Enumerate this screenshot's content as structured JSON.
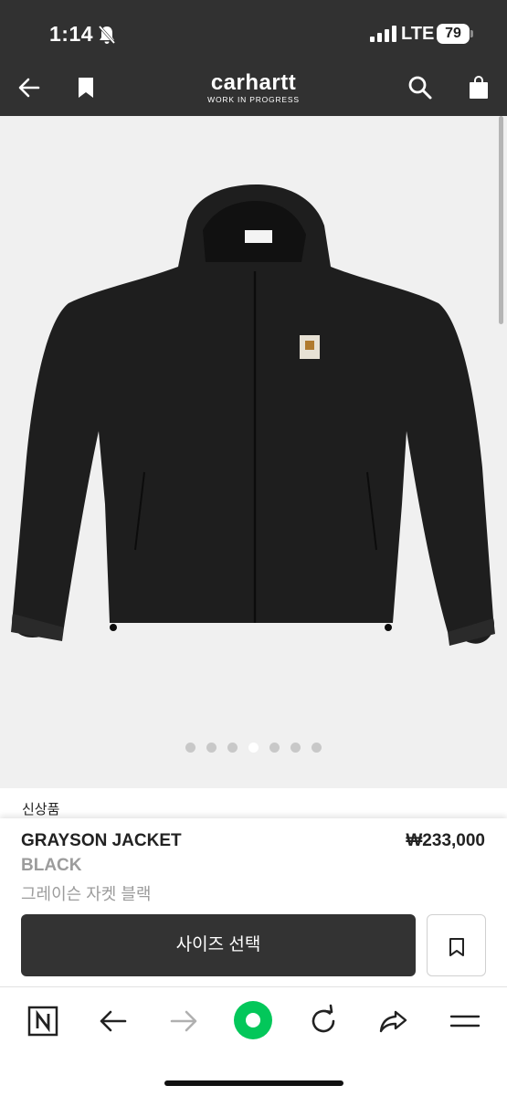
{
  "status_bar": {
    "time": "1:14",
    "network": "LTE",
    "battery": "79"
  },
  "header": {
    "brand": "carhartt",
    "brand_tagline": "WORK IN PROGRESS",
    "icons": [
      "back-arrow-icon",
      "bookmark-icon",
      "search-icon",
      "shopping-bag-icon"
    ]
  },
  "gallery": {
    "image": "black hooded zip jacket with square logo patch",
    "slide_count": 7,
    "active_slide": 4
  },
  "product": {
    "badge": "신상품",
    "name": "GRAYSON JACKET",
    "price": "₩233,000",
    "color": "BLACK",
    "name_korean": "그레이슨 자켓 블랙",
    "size_button": "사이즈 선택"
  },
  "browser_toolbar": {
    "icons": [
      "n-home-icon",
      "back-icon",
      "forward-icon",
      "green-dot-icon",
      "reload-icon",
      "share-icon",
      "menu-icon"
    ]
  },
  "colors": {
    "header_bg": "#313131",
    "button_dark": "#333333",
    "accent_green": "#03c75a"
  }
}
